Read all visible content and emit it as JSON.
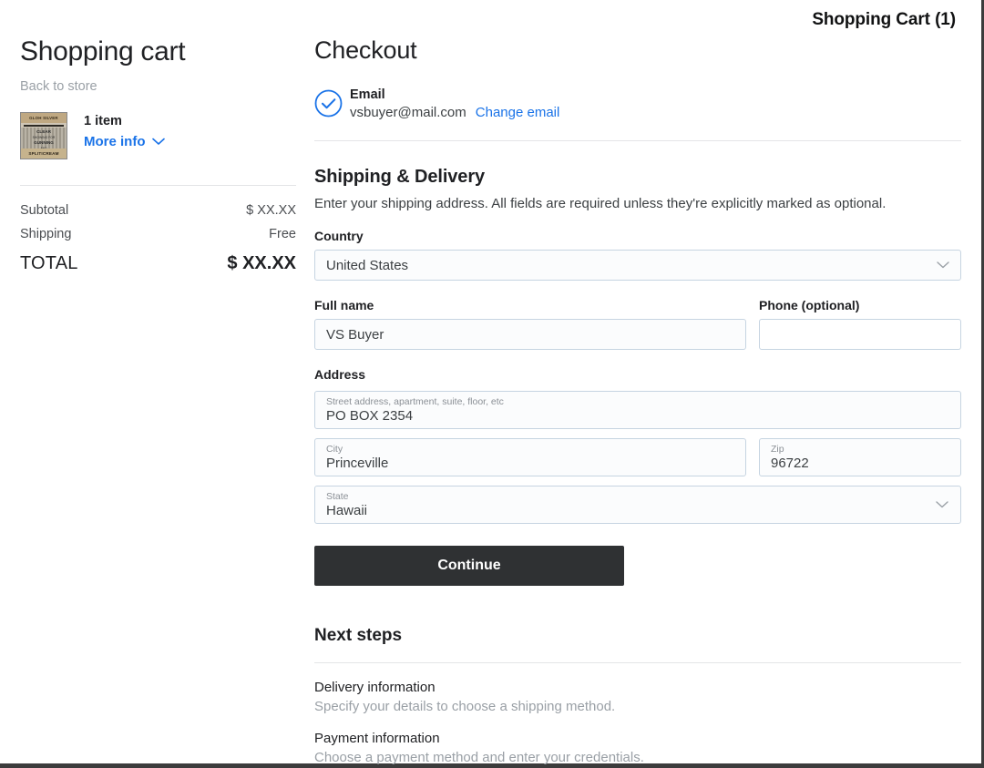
{
  "header": {
    "cart_badge": "Shopping Cart (1)"
  },
  "sidebar": {
    "title": "Shopping cart",
    "back_link": "Back to store",
    "item": {
      "count_label": "1 item",
      "more_info_label": "More info",
      "thumbnail": {
        "top_band": "GLOH SILVER",
        "line1": "CLEAR",
        "line2": "SHOWING FOR",
        "line3": "GUNNING",
        "line4": "AND",
        "line5": "Triple",
        "bottom_band": "SPLITICREAM"
      }
    },
    "totals": [
      {
        "label": "Subtotal",
        "currency": "$",
        "value": "XX.XX"
      },
      {
        "label": "Shipping",
        "currency": "",
        "value": "Free"
      }
    ],
    "total": {
      "label": "TOTAL",
      "currency": "$",
      "value": "XX.XX"
    }
  },
  "checkout": {
    "title": "Checkout",
    "email": {
      "label": "Email",
      "address": "vsbuyer@mail.com",
      "change_link": "Change email",
      "status_icon": "check-circle-icon"
    },
    "shipping": {
      "title": "Shipping & Delivery",
      "description": "Enter your shipping address. All fields are required unless they're explicitly marked as optional.",
      "country": {
        "label": "Country",
        "value": "United States"
      },
      "full_name": {
        "label": "Full name",
        "value": "VS Buyer"
      },
      "phone": {
        "label": "Phone (optional)",
        "value": "",
        "placeholder": ""
      },
      "address_group_label": "Address",
      "street": {
        "label": "Street address, apartment, suite, floor, etc",
        "value": "PO BOX 2354"
      },
      "city": {
        "label": "City",
        "value": "Princeville"
      },
      "zip": {
        "label": "Zip",
        "value": "96722"
      },
      "state": {
        "label": "State",
        "value": "Hawaii"
      },
      "continue_label": "Continue"
    },
    "next_steps": {
      "title": "Next steps",
      "steps": [
        {
          "title": "Delivery information",
          "description": "Specify your details to choose a shipping method."
        },
        {
          "title": "Payment information",
          "description": "Choose a payment method and enter your credentials."
        }
      ]
    }
  },
  "colors": {
    "link_blue": "#1a73e8",
    "button_dark": "#2f3133",
    "muted_gray": "#9aa0a6",
    "field_border": "#c6d4e1"
  }
}
